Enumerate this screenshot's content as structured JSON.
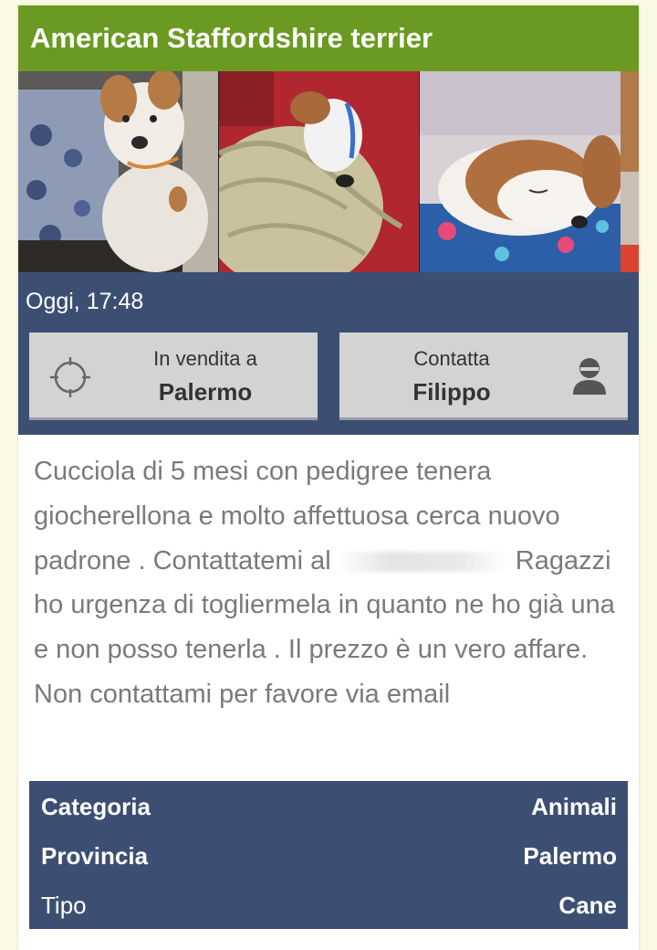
{
  "header": {
    "title": "American Staffordshire terrier"
  },
  "gallery": {
    "photos": [
      {
        "icon": "dog-photo-sitting"
      },
      {
        "icon": "dog-photo-sleeping-blanket"
      },
      {
        "icon": "dog-photo-sleeping"
      },
      {
        "icon": "dog-photo-partial"
      }
    ]
  },
  "listing": {
    "date": "Oggi, 17:48",
    "location_button": {
      "label": "In vendita a",
      "value": "Palermo",
      "icon": "crosshair-icon"
    },
    "contact_button": {
      "label": "Contatta",
      "value": "Filippo",
      "icon": "user-icon"
    }
  },
  "description": {
    "part1": "Cucciola di 5 mesi con pedigree tenera giocherellona e molto affettuosa cerca nuovo padrone . Contattatemi al",
    "part2": "Ragazzi ho urgenza di togliermela in quanto ne ho già una e non posso tenerla . Il prezzo è un vero affare. Non contattami per favore via email"
  },
  "details": [
    {
      "key": "Categoria",
      "value": "Animali",
      "key_bold": true
    },
    {
      "key": "Provincia",
      "value": "Palermo",
      "key_bold": true
    },
    {
      "key": "Tipo",
      "value": "Cane",
      "key_bold": false
    }
  ],
  "colors": {
    "header_bg": "#6a9a22",
    "panel_bg": "#3c4f73",
    "page_bg": "#fbf9e3",
    "button_bg": "#d3d3d3"
  }
}
